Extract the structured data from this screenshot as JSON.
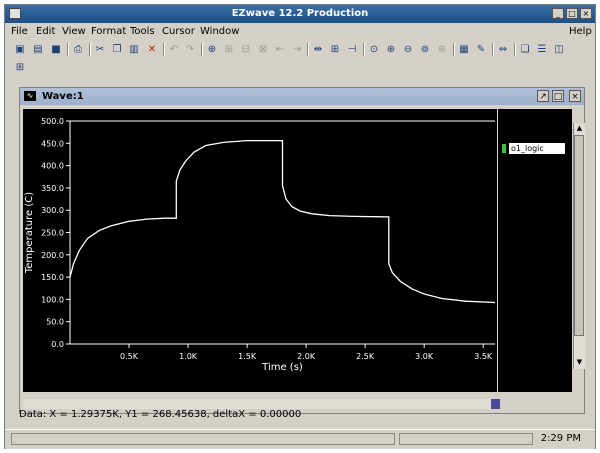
{
  "window": {
    "title": "EZwave 12.2 Production"
  },
  "menu": [
    "File",
    "Edit",
    "View",
    "Format",
    "Tools",
    "Cursor",
    "Window"
  ],
  "help": "Help",
  "wave_window": {
    "title": "Wave:1"
  },
  "legend": {
    "signal": "o1_logic",
    "color": "#3fbf3f"
  },
  "status": "Data: X = 1.29375K,  Y1 = 268.45638,  deltaX = 0.00000",
  "clock": "2:29 PM",
  "chart_data": {
    "type": "line",
    "xlabel": "Time (s)",
    "ylabel": "Temperature (C)",
    "xlim": [
      0,
      3.6
    ],
    "ylim": [
      0,
      500
    ],
    "x_ticks": [
      0.5,
      1.0,
      1.5,
      2.0,
      2.5,
      3.0,
      3.5
    ],
    "x_tick_labels": [
      "0.5K",
      "1.0K",
      "1.5K",
      "2.0K",
      "2.5K",
      "3.0K",
      "3.5K"
    ],
    "y_ticks": [
      0,
      50,
      100,
      150,
      200,
      250,
      300,
      350,
      400,
      450,
      500
    ],
    "y_tick_labels": [
      "0.0",
      "50.0",
      "100.0",
      "150.0",
      "200.0",
      "250.0",
      "300.0",
      "350.0",
      "400.0",
      "450.0",
      "500.0"
    ],
    "grid": false,
    "line_color": "#ffffff",
    "series": [
      {
        "x": [
          0,
          0.03,
          0.08,
          0.15,
          0.25,
          0.35,
          0.5,
          0.65,
          0.8,
          0.9,
          0.9,
          0.93,
          0.98,
          1.05,
          1.15,
          1.3,
          1.5,
          1.8,
          1.8,
          1.83,
          1.88,
          1.95,
          2.05,
          2.2,
          2.4,
          2.7,
          2.7,
          2.73,
          2.8,
          2.9,
          3.0,
          3.15,
          3.35,
          3.6
        ],
        "y": [
          150,
          180,
          210,
          237,
          255,
          265,
          275,
          280,
          282,
          282,
          365,
          390,
          410,
          430,
          445,
          452,
          456,
          456,
          355,
          325,
          308,
          298,
          292,
          288,
          286,
          285,
          180,
          160,
          140,
          123,
          112,
          102,
          96,
          93
        ]
      }
    ]
  }
}
